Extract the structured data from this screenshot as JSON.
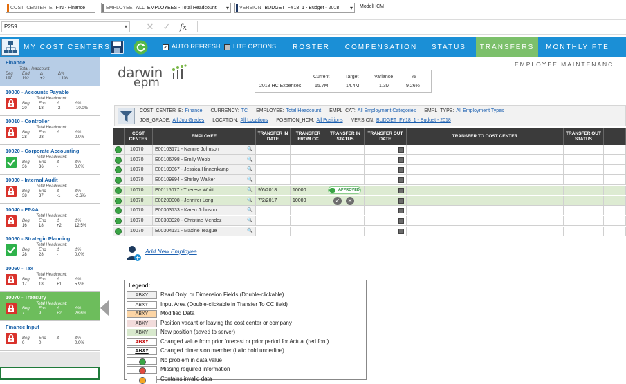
{
  "dims": [
    {
      "label": "COST_CENTER_E",
      "value": "FIN - Finance",
      "color": "#e36c0a"
    },
    {
      "label": "EMPLOYEE",
      "value": "ALL_EMPLOYEES - Total Headcount",
      "color": "#7f7f7f"
    },
    {
      "label": "VERSION",
      "value": "BUDGET_FY18_1 - Budget - 2018",
      "color": "#1f3864"
    }
  ],
  "model_name": "ModelHCM",
  "formula": {
    "namebox": "P259",
    "fx": "fx"
  },
  "nav": {
    "title": "MY COST CENTERS",
    "auto_refresh": "AUTO REFRESH",
    "lite_options": "LITE OPTIONS",
    "tabs": [
      "ROSTER",
      "COMPENSATION",
      "STATUS",
      "TRANSFERS",
      "MONTHLY FTE"
    ],
    "active_tab": "TRANSFERS"
  },
  "sidebar": {
    "cards": [
      {
        "name": "Finance",
        "headcount_label": "Total Headcount:",
        "hdr": [
          "Beg",
          "End",
          "Δ",
          "Δ%"
        ],
        "vals": [
          "190",
          "192",
          "+2",
          "1.1%"
        ],
        "status": "none"
      },
      {
        "name": "10000 - Accounts Payable",
        "headcount_label": "Total Headcount:",
        "hdr": [
          "Beg",
          "End",
          "Δ",
          "Δ%"
        ],
        "vals": [
          "20",
          "18",
          "-2",
          "-10.0%"
        ],
        "status": "lock"
      },
      {
        "name": "10010 - Controller",
        "headcount_label": "Total Headcount:",
        "hdr": [
          "Beg",
          "End",
          "Δ",
          "Δ%"
        ],
        "vals": [
          "28",
          "28",
          "-",
          "0.0%"
        ],
        "status": "lock"
      },
      {
        "name": "10020 - Corporate Accounting",
        "headcount_label": "Total Headcount:",
        "hdr": [
          "Beg",
          "End",
          "Δ",
          "Δ%"
        ],
        "vals": [
          "36",
          "36",
          "-",
          "0.0%"
        ],
        "status": "ok"
      },
      {
        "name": "10030 - Internal Audit",
        "headcount_label": "Total Headcount:",
        "hdr": [
          "Beg",
          "End",
          "Δ",
          "Δ%"
        ],
        "vals": [
          "38",
          "37",
          "-1",
          "-2.6%"
        ],
        "status": "lock"
      },
      {
        "name": "10040 - FP&A",
        "headcount_label": "Total Headcount:",
        "hdr": [
          "Beg",
          "End",
          "Δ",
          "Δ%"
        ],
        "vals": [
          "16",
          "18",
          "+2",
          "12.5%"
        ],
        "status": "lock"
      },
      {
        "name": "10050 - Strategic Planning",
        "headcount_label": "Total Headcount:",
        "hdr": [
          "Beg",
          "End",
          "Δ",
          "Δ%"
        ],
        "vals": [
          "28",
          "28",
          "-",
          "0.0%"
        ],
        "status": "ok"
      },
      {
        "name": "10060 - Tax",
        "headcount_label": "Total Headcount:",
        "hdr": [
          "Beg",
          "End",
          "Δ",
          "Δ%"
        ],
        "vals": [
          "17",
          "18",
          "+1",
          "5.9%"
        ],
        "status": "lock"
      },
      {
        "name": "10070 - Treasury",
        "headcount_label": "Total Headcount:",
        "hdr": [
          "Beg",
          "End",
          "Δ",
          "Δ%"
        ],
        "vals": [
          "7",
          "9",
          "+2",
          "28.6%"
        ],
        "status": "lock"
      },
      {
        "name": "Finance Input",
        "headcount_label": "",
        "hdr": [
          "Beg",
          "End",
          "Δ",
          "Δ%"
        ],
        "vals": [
          "0",
          "0",
          "-",
          "0.0%"
        ],
        "status": "lock"
      }
    ],
    "selected": 8
  },
  "logo": {
    "a": "darwin",
    "b": "epm"
  },
  "page_title": "EMPLOYEE MAINTENANC",
  "kpi": {
    "headers": [
      "Current",
      "Target",
      "Variance",
      "%"
    ],
    "row_label": "2018 HC Expenses",
    "values": [
      "15.7M",
      "14.4M",
      "1.3M",
      "9.26%"
    ]
  },
  "filters": {
    "row1": [
      {
        "label": "COST_CENTER_E:",
        "value": "Finance"
      },
      {
        "label": "CURRENCY:",
        "value": "TC"
      },
      {
        "label": "EMPLOYEE:",
        "value": "Total Headcount"
      },
      {
        "label": "EMPL_CAT:",
        "value": "All Employment Categories"
      },
      {
        "label": "EMPL_TYPE:",
        "value": "All Employment Types"
      }
    ],
    "row2": [
      {
        "label": "JOB_GRADE:",
        "value": "All Job Grades"
      },
      {
        "label": "LOCATION:",
        "value": "All Locations"
      },
      {
        "label": "POSITION_HCM:",
        "value": "All Positions"
      },
      {
        "label": "VERSION:",
        "value": "BUDGET_FY18_1 - Budget - 2018"
      }
    ]
  },
  "grid": {
    "headers": [
      "",
      "COST CENTER",
      "EMPLOYEE",
      "TRANSFER IN DATE",
      "TRANSFER FROM CC",
      "TRANSFER IN STATUS",
      "TRANSFER OUT DATE",
      "TRANSFER TO COST CENTER",
      "TRANSFER OUT STATUS"
    ],
    "rows": [
      {
        "cc": "10070",
        "emp": "E00103171 - Nannie Johnson",
        "in_date": "",
        "from_cc": "",
        "status": "",
        "saved": false
      },
      {
        "cc": "10070",
        "emp": "E00106798 - Emily Webb",
        "in_date": "",
        "from_cc": "",
        "status": "",
        "saved": false
      },
      {
        "cc": "10070",
        "emp": "E00109367 - Jessica Hinnenkamp",
        "in_date": "",
        "from_cc": "",
        "status": "",
        "saved": false
      },
      {
        "cc": "10070",
        "emp": "E00109894 - Shirley Walker",
        "in_date": "",
        "from_cc": "",
        "status": "",
        "saved": false
      },
      {
        "cc": "10070",
        "emp": "E00115077 - Theresa Whitt",
        "in_date": "9/6/2018",
        "from_cc": "10000",
        "status": "APPROVED",
        "saved": true
      },
      {
        "cc": "10070",
        "emp": "E00200008 - Jennifer Long",
        "in_date": "7/2/2017",
        "from_cc": "10000",
        "status": "actions",
        "saved": true
      },
      {
        "cc": "10070",
        "emp": "E00303133 - Karen Johnson",
        "in_date": "",
        "from_cc": "",
        "status": "",
        "saved": false
      },
      {
        "cc": "10070",
        "emp": "E00303920 - Christine Mendez",
        "in_date": "",
        "from_cc": "",
        "status": "",
        "saved": false
      },
      {
        "cc": "10070",
        "emp": "E00304131 - Maxine Teague",
        "in_date": "",
        "from_cc": "",
        "status": "",
        "saved": false
      }
    ]
  },
  "add_employee": "Add New Employee",
  "legend": {
    "title": "Legend:",
    "items": [
      {
        "swatch": "ABXY",
        "bg": "#f0f0f0",
        "color": "#333",
        "style": "normal",
        "text": "Read Only, or Dimension Fields (Double-clickable)"
      },
      {
        "swatch": "ABXY",
        "bg": "#ffffff",
        "color": "#333",
        "style": "normal",
        "text": "Input Area (Double-clickable in Transfer To CC field)"
      },
      {
        "swatch": "ABXY",
        "bg": "#fcd5a5",
        "color": "#333",
        "style": "normal",
        "text": "Modified Data"
      },
      {
        "swatch": "ABXY",
        "bg": "#f2dcdb",
        "color": "#333",
        "style": "normal",
        "text": "Position vacant or leaving the cost center or company"
      },
      {
        "swatch": "ABXY",
        "bg": "#d8e9cd",
        "color": "#333",
        "style": "normal",
        "text": "New position (saved to server)"
      },
      {
        "swatch": "ABXY",
        "bg": "#ffffff",
        "color": "#c00000",
        "style": "bold",
        "text": "Changed value from prior forecast or prior period for Actual (red font)"
      },
      {
        "swatch": "ABXY",
        "bg": "#ffffff",
        "color": "#111",
        "style": "italic-underline",
        "text": "Changed dimension member (italic bold underline)"
      },
      {
        "swatch": "",
        "bg": "#3aa545",
        "color": "",
        "style": "circle",
        "text": "No problem in data value"
      },
      {
        "swatch": "",
        "bg": "#e04b3f",
        "color": "",
        "style": "circle",
        "text": "Missing required information"
      },
      {
        "swatch": "",
        "bg": "#f5a623",
        "color": "",
        "style": "circle",
        "text": "Contains invalid data"
      }
    ]
  }
}
